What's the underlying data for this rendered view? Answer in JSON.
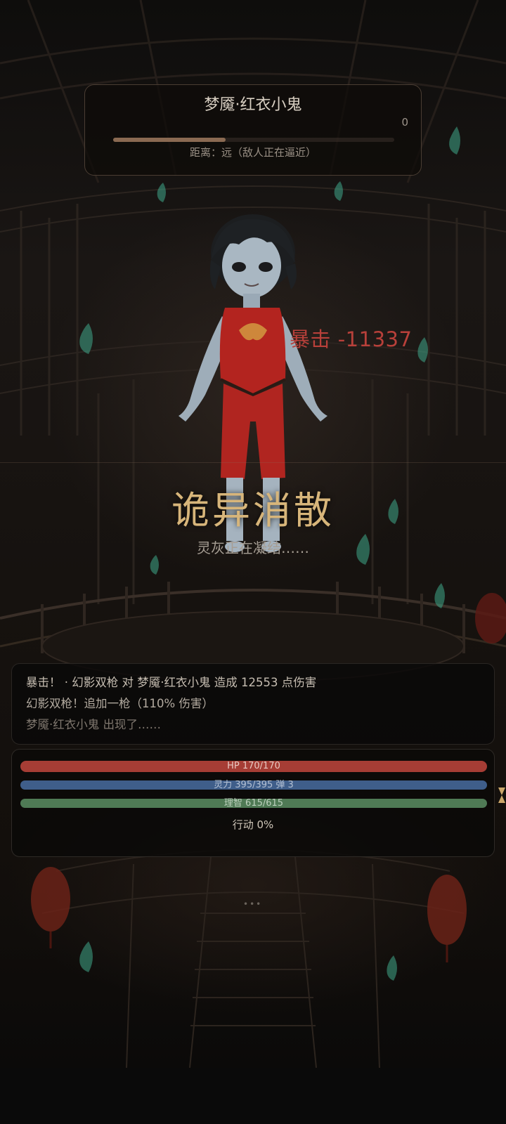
{
  "enemy": {
    "name": "梦魇·红衣小鬼",
    "hp_value": "0",
    "hp_fraction": 0.4,
    "distance_text": "距离：远（敌人正在逼近）"
  },
  "battle": {
    "crit_popup": "暴击 -11337",
    "result_title": "诡异消散",
    "result_subtitle": "灵灰正在凝结……"
  },
  "log": {
    "lines": [
      "暴击！ · 幻影双枪 对 梦魇·红衣小鬼 造成 12553 点伤害",
      "幻影双枪！追加一枪（110% 伤害）",
      "梦魇·红衣小鬼 出现了……"
    ]
  },
  "stats": {
    "hp_text": "HP 170/170",
    "hp_fraction": 1.0,
    "spirit_text": "灵力 395/395  弹 3",
    "spirit_fraction": 1.0,
    "sanity_text": "理智 615/615",
    "sanity_fraction": 1.0,
    "action_text": "行动 0%"
  },
  "footer": {
    "dots": "•••"
  },
  "colors": {
    "hp": "#a63d35",
    "spirit": "#3f5e8a",
    "sanity": "#4f7a55",
    "crit": "#b8403a",
    "title_gold": "#d7b57a"
  }
}
